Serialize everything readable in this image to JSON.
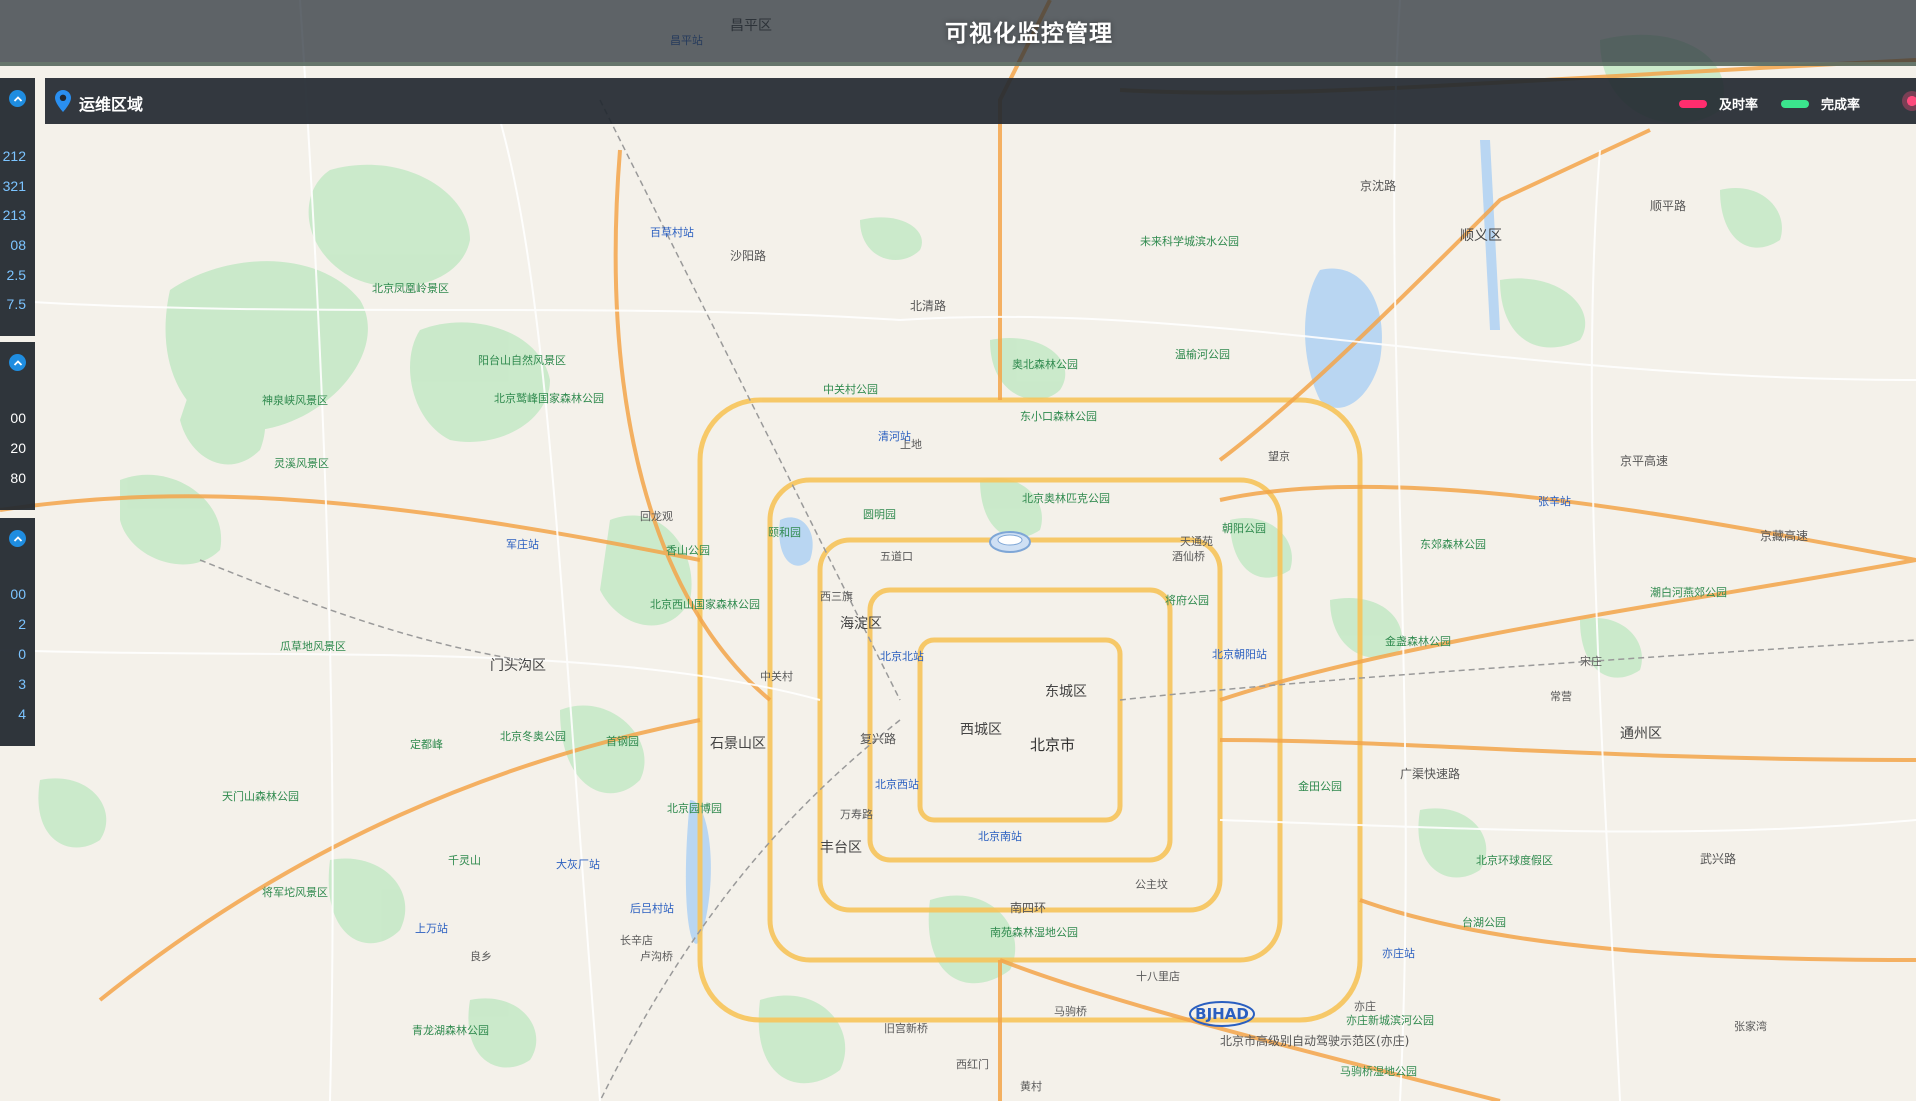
{
  "header": {
    "title": "可视化监控管理"
  },
  "region_bar": {
    "title": "运维区域",
    "legend": [
      {
        "label": "及时率",
        "color": "#ff2d6e"
      },
      {
        "label": "完成率",
        "color": "#3be58d"
      }
    ]
  },
  "side_panels": [
    {
      "values": [
        "212",
        "321",
        "213",
        "08",
        "2.5",
        "7.5"
      ],
      "value_color": "#5ab4ff"
    },
    {
      "values": [
        "00",
        "20",
        "80"
      ],
      "value_color": "#ffffff"
    },
    {
      "values": [
        "00",
        "2",
        "0",
        "3",
        "4"
      ],
      "value_color": "#5ab4ff"
    }
  ],
  "map": {
    "districts": [
      "昌平区",
      "顺义区",
      "海淀区",
      "东城区",
      "西城区",
      "北京市",
      "石景山区",
      "门头沟区",
      "丰台区",
      "通州区"
    ],
    "roads": [
      "北清路",
      "沙阳路",
      "京平高速",
      "京藏高速",
      "复兴路",
      "广渠快速路",
      "武兴路",
      "顺平路",
      "京沈路",
      "南四环",
      "北京市高级别自动驾驶示范区(亦庄)"
    ],
    "stations": [
      "北京北站",
      "北京西站",
      "北京南站",
      "北京朝阳站",
      "清河站",
      "昌平站",
      "百草村站",
      "军庄站",
      "张辛站",
      "亦庄站",
      "大灰厂站",
      "后吕村站",
      "上万站"
    ],
    "parks": [
      "北京奥林匹克公园",
      "奥北森林公园",
      "中关村公园",
      "东小口森林公园",
      "圆明园",
      "颐和园",
      "香山公园",
      "北京西山国家森林公园",
      "朝阳公园",
      "温榆河公园",
      "未来科学城滨水公园",
      "将府公园",
      "东郊森林公园",
      "金盏森林公园",
      "潮白河燕郊公园",
      "北京园博园",
      "金田公园",
      "台湖公园",
      "北京环球度假区",
      "南苑森林湿地公园",
      "首钢园",
      "北京冬奥公园",
      "定都峰",
      "瓜草地风景区",
      "北京凤凰岭景区",
      "阳台山自然风景区",
      "神泉峡风景区",
      "灵溪风景区",
      "北京鹫峰国家森林公园",
      "将军坨风景区",
      "千灵山",
      "天门山森林公园",
      "青龙湖森林公园",
      "亦庄新城滨河公园",
      "马驹桥湿地公园"
    ],
    "places": [
      "上地",
      "西三旗",
      "回龙观",
      "天通苑",
      "望京",
      "酒仙桥",
      "五道口",
      "中关村",
      "万寿路",
      "公主坟",
      "十八里店",
      "亦庄",
      "马驹桥",
      "旧宫新桥",
      "西红门",
      "黄村",
      "良乡",
      "长辛店",
      "卢沟桥",
      "常营",
      "宋庄",
      "张家湾"
    ],
    "bjhad_label": "BJHAD"
  }
}
